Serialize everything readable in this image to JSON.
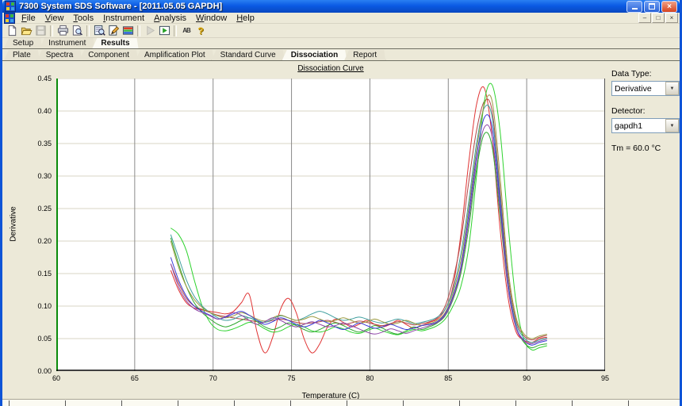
{
  "window": {
    "title": "7300 System SDS Software - [2011.05.05 GAPDH]",
    "buttons": [
      "minimize",
      "restore",
      "close"
    ]
  },
  "menu": {
    "items": [
      "File",
      "View",
      "Tools",
      "Instrument",
      "Analysis",
      "Window",
      "Help"
    ]
  },
  "mdi": {
    "buttons": [
      "minimize",
      "restore",
      "close"
    ]
  },
  "toolbar": {
    "groups": [
      [
        "new-document",
        "open-file",
        "save"
      ],
      [
        "print",
        "print-preview"
      ],
      [
        "find-wells",
        "edit-document",
        "well-plate"
      ],
      [
        "run-instrument",
        "view-results"
      ],
      [
        "ab-quantification",
        "help"
      ]
    ],
    "disabled": [
      "save",
      "run-instrument"
    ],
    "ab_label": "AB",
    "help_glyph": "?"
  },
  "tabs_primary": {
    "active": "Results",
    "items": [
      "Setup",
      "Instrument",
      "Results"
    ]
  },
  "tabs_secondary": {
    "active": "Dissociation",
    "items": [
      "Plate",
      "Spectra",
      "Component",
      "Amplification Plot",
      "Standard Curve",
      "Dissociation",
      "Report"
    ]
  },
  "side_panel": {
    "data_type_label": "Data Type:",
    "data_type_value": "Derivative",
    "detector_label": "Detector:",
    "detector_value": "gapdh1",
    "tm_text": "Tm = 60.0 °C",
    "dropdown_icon": "chevron-down"
  },
  "chart_data": {
    "type": "line",
    "title": "Dissociation Curve",
    "xlabel": "Temperature (C)",
    "ylabel": "Derivative",
    "xlim": [
      60,
      95
    ],
    "ylim": [
      0,
      0.45
    ],
    "x_ticks": [
      60,
      65,
      70,
      75,
      80,
      85,
      90,
      95
    ],
    "y_ticks": [
      "0.00",
      "0.05",
      "0.10",
      "0.15",
      "0.20",
      "0.25",
      "0.30",
      "0.35",
      "0.40",
      "0.45"
    ],
    "grid": {
      "h_color": "#d9d5c5",
      "v_color": "#8a8a8a",
      "y_axis_color": "#0a8a0a",
      "x_axis_color": "#000000",
      "plot_bg": "#ffffff"
    },
    "legend": "none",
    "x": [
      67.3,
      67.8,
      68.3,
      68.8,
      69.3,
      69.8,
      70.3,
      70.8,
      71.3,
      71.8,
      72.3,
      72.8,
      73.3,
      73.8,
      74.3,
      74.8,
      75.3,
      75.8,
      76.3,
      76.8,
      77.3,
      77.8,
      78.3,
      78.8,
      79.3,
      79.8,
      80.3,
      80.8,
      81.3,
      81.8,
      82.3,
      82.8,
      83.3,
      83.8,
      84.3,
      84.8,
      85.3,
      85.8,
      86.3,
      86.8,
      87.3,
      87.8,
      88.3,
      88.8,
      89.3,
      89.8,
      90.3,
      90.8,
      91.3
    ],
    "series": [
      {
        "name": "curve-1",
        "color": "#e03434",
        "values": [
          0.155,
          0.125,
          0.105,
          0.097,
          0.094,
          0.092,
          0.09,
          0.088,
          0.092,
          0.105,
          0.118,
          0.06,
          0.028,
          0.052,
          0.095,
          0.112,
          0.09,
          0.05,
          0.028,
          0.042,
          0.068,
          0.08,
          0.075,
          0.068,
          0.072,
          0.078,
          0.072,
          0.068,
          0.072,
          0.078,
          0.072,
          0.066,
          0.07,
          0.075,
          0.08,
          0.095,
          0.13,
          0.21,
          0.32,
          0.41,
          0.435,
          0.36,
          0.22,
          0.115,
          0.062,
          0.048,
          0.044,
          0.05,
          0.052
        ]
      },
      {
        "name": "curve-2",
        "color": "#b04848",
        "values": [
          0.165,
          0.135,
          0.112,
          0.1,
          0.095,
          0.09,
          0.086,
          0.084,
          0.082,
          0.08,
          0.078,
          0.076,
          0.075,
          0.078,
          0.08,
          0.078,
          0.075,
          0.073,
          0.074,
          0.076,
          0.078,
          0.075,
          0.072,
          0.074,
          0.077,
          0.075,
          0.072,
          0.07,
          0.073,
          0.076,
          0.074,
          0.071,
          0.073,
          0.076,
          0.082,
          0.1,
          0.14,
          0.2,
          0.29,
          0.37,
          0.415,
          0.4,
          0.28,
          0.15,
          0.08,
          0.055,
          0.048,
          0.052,
          0.055
        ]
      },
      {
        "name": "curve-3",
        "color": "#2ed32e",
        "values": [
          0.22,
          0.21,
          0.185,
          0.14,
          0.1,
          0.075,
          0.064,
          0.062,
          0.065,
          0.07,
          0.075,
          0.072,
          0.065,
          0.06,
          0.062,
          0.068,
          0.072,
          0.068,
          0.062,
          0.06,
          0.063,
          0.068,
          0.065,
          0.06,
          0.058,
          0.062,
          0.066,
          0.062,
          0.058,
          0.056,
          0.06,
          0.064,
          0.062,
          0.065,
          0.07,
          0.08,
          0.1,
          0.13,
          0.19,
          0.3,
          0.415,
          0.44,
          0.37,
          0.23,
          0.11,
          0.05,
          0.033,
          0.036,
          0.039
        ]
      },
      {
        "name": "curve-4",
        "color": "#30a830",
        "values": [
          0.205,
          0.165,
          0.13,
          0.105,
          0.09,
          0.08,
          0.072,
          0.068,
          0.072,
          0.078,
          0.082,
          0.076,
          0.068,
          0.064,
          0.068,
          0.074,
          0.07,
          0.064,
          0.06,
          0.064,
          0.07,
          0.074,
          0.07,
          0.064,
          0.06,
          0.064,
          0.07,
          0.066,
          0.06,
          0.057,
          0.062,
          0.068,
          0.064,
          0.068,
          0.074,
          0.085,
          0.11,
          0.15,
          0.22,
          0.31,
          0.365,
          0.345,
          0.24,
          0.13,
          0.07,
          0.045,
          0.036,
          0.04,
          0.042
        ]
      },
      {
        "name": "curve-5",
        "color": "#3f9f9f",
        "values": [
          0.21,
          0.175,
          0.14,
          0.115,
          0.1,
          0.09,
          0.082,
          0.078,
          0.08,
          0.085,
          0.082,
          0.078,
          0.075,
          0.08,
          0.085,
          0.082,
          0.078,
          0.082,
          0.088,
          0.092,
          0.088,
          0.082,
          0.078,
          0.08,
          0.083,
          0.08,
          0.076,
          0.074,
          0.077,
          0.08,
          0.077,
          0.073,
          0.075,
          0.078,
          0.083,
          0.095,
          0.125,
          0.18,
          0.26,
          0.35,
          0.405,
          0.39,
          0.27,
          0.14,
          0.075,
          0.052,
          0.044,
          0.048,
          0.051
        ]
      },
      {
        "name": "curve-6",
        "color": "#9a9a40",
        "values": [
          0.2,
          0.16,
          0.13,
          0.11,
          0.098,
          0.09,
          0.085,
          0.082,
          0.085,
          0.09,
          0.086,
          0.08,
          0.077,
          0.082,
          0.086,
          0.082,
          0.078,
          0.08,
          0.084,
          0.08,
          0.076,
          0.078,
          0.082,
          0.078,
          0.074,
          0.076,
          0.08,
          0.076,
          0.072,
          0.074,
          0.078,
          0.074,
          0.07,
          0.073,
          0.078,
          0.09,
          0.12,
          0.17,
          0.25,
          0.34,
          0.41,
          0.415,
          0.3,
          0.16,
          0.085,
          0.058,
          0.05,
          0.054,
          0.057
        ]
      },
      {
        "name": "curve-7",
        "color": "#3a3ad8",
        "values": [
          0.175,
          0.14,
          0.115,
          0.1,
          0.092,
          0.086,
          0.08,
          0.083,
          0.088,
          0.092,
          0.086,
          0.078,
          0.072,
          0.076,
          0.082,
          0.078,
          0.072,
          0.068,
          0.072,
          0.078,
          0.074,
          0.068,
          0.064,
          0.068,
          0.074,
          0.07,
          0.066,
          0.068,
          0.072,
          0.068,
          0.064,
          0.066,
          0.07,
          0.072,
          0.076,
          0.088,
          0.115,
          0.16,
          0.24,
          0.33,
          0.39,
          0.375,
          0.26,
          0.135,
          0.07,
          0.048,
          0.04,
          0.044,
          0.047
        ]
      },
      {
        "name": "curve-8",
        "color": "#9048a8",
        "values": [
          0.165,
          0.13,
          0.108,
          0.096,
          0.09,
          0.085,
          0.08,
          0.084,
          0.09,
          0.086,
          0.078,
          0.072,
          0.076,
          0.082,
          0.078,
          0.072,
          0.068,
          0.072,
          0.076,
          0.072,
          0.068,
          0.07,
          0.074,
          0.07,
          0.065,
          0.06,
          0.057,
          0.06,
          0.065,
          0.062,
          0.058,
          0.062,
          0.066,
          0.07,
          0.075,
          0.086,
          0.112,
          0.155,
          0.23,
          0.32,
          0.375,
          0.36,
          0.25,
          0.13,
          0.068,
          0.047,
          0.042,
          0.046,
          0.049
        ]
      }
    ]
  }
}
